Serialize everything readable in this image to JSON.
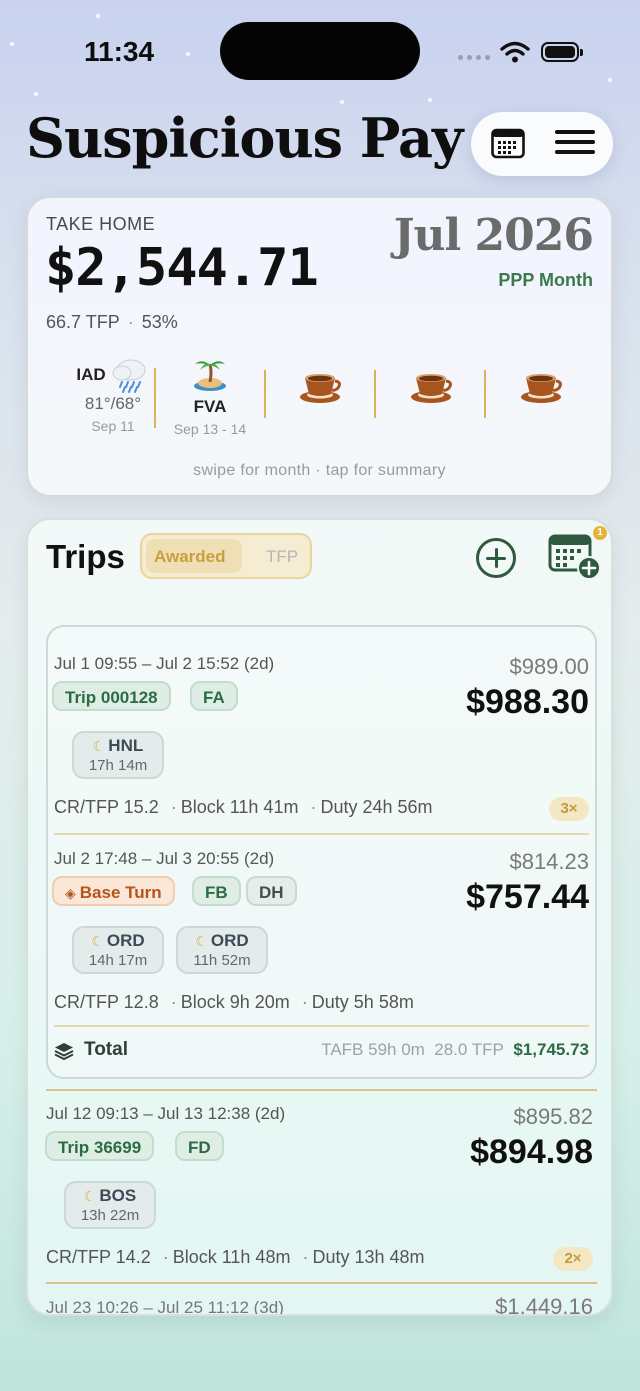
{
  "status_bar": {
    "time": "11:34"
  },
  "header": {
    "title": "Suspicious Pay",
    "calendar_icon": "calendar-icon",
    "menu_icon": "menu-icon"
  },
  "summary": {
    "label": "TAKE HOME",
    "amount": "$2,544.71",
    "tfp": "66.7 TFP",
    "separator": "·",
    "percent": "53%",
    "month": "Jul 2026",
    "month_sub": "PPP Month",
    "days": [
      {
        "code": "IAD",
        "icon": "rain-cloud-icon",
        "temp": "81°/68°",
        "date": "Sep 11"
      },
      {
        "code": "FVA",
        "icon": "palm-island-icon",
        "date": "Sep 13 - 14"
      },
      {
        "icon": "coffee-cup-icon"
      },
      {
        "icon": "coffee-cup-icon"
      },
      {
        "icon": "coffee-cup-icon"
      }
    ],
    "hint": "swipe for month · tap for summary"
  },
  "trips": {
    "title": "Trips",
    "segment": {
      "awarded": "Awarded",
      "tfp": "TFP"
    },
    "calendar_badge": "1",
    "group": [
      {
        "dates": "Jul 1 09:55 – Jul 2 15:52 (2d)",
        "prev_pay": "$989.00",
        "pay": "$988.30",
        "chips": [
          "Trip 000128",
          "FA"
        ],
        "layovers": [
          {
            "code": "HNL",
            "time": "17h 14m"
          }
        ],
        "stats": {
          "crtfp": "CR/TFP 15.2",
          "block": "Block 11h 41m",
          "duty": "Duty 24h 56m",
          "sep": "·"
        },
        "multiplier": "3×"
      },
      {
        "dates": "Jul 2 17:48 – Jul 3 20:55 (2d)",
        "prev_pay": "$814.23",
        "pay": "$757.44",
        "chips": [
          "Base Turn",
          "FB",
          "DH"
        ],
        "layovers": [
          {
            "code": "ORD",
            "time": "14h 17m"
          },
          {
            "code": "ORD",
            "time": "11h 52m"
          }
        ],
        "stats": {
          "crtfp": "CR/TFP 12.8",
          "block": "Block 9h 20m",
          "duty": "Duty 5h 58m",
          "sep": "·"
        }
      }
    ],
    "total": {
      "label": "Total",
      "tafb": "TAFB 59h 0m",
      "tfp": "28.0 TFP",
      "amount": "$1,745.73"
    },
    "standalone": {
      "dates": "Jul 12 09:13 – Jul 13 12:38 (2d)",
      "prev_pay": "$895.82",
      "pay": "$894.98",
      "chips": [
        "Trip 36699",
        "FD"
      ],
      "layovers": [
        {
          "code": "BOS",
          "time": "13h 22m"
        }
      ],
      "stats": {
        "crtfp": "CR/TFP 14.2",
        "block": "Block 11h 48m",
        "duty": "Duty 13h 48m",
        "sep": "·"
      },
      "multiplier": "2×"
    },
    "next_partial": {
      "dates": "Jul 23 10:26 – Jul 25 11:12 (3d)",
      "prev_pay": "$1,449.16"
    }
  },
  "colors": {
    "accent_green": "#2f5a40",
    "gold": "#d9b45f",
    "brand_text": "#0e0e0e"
  }
}
